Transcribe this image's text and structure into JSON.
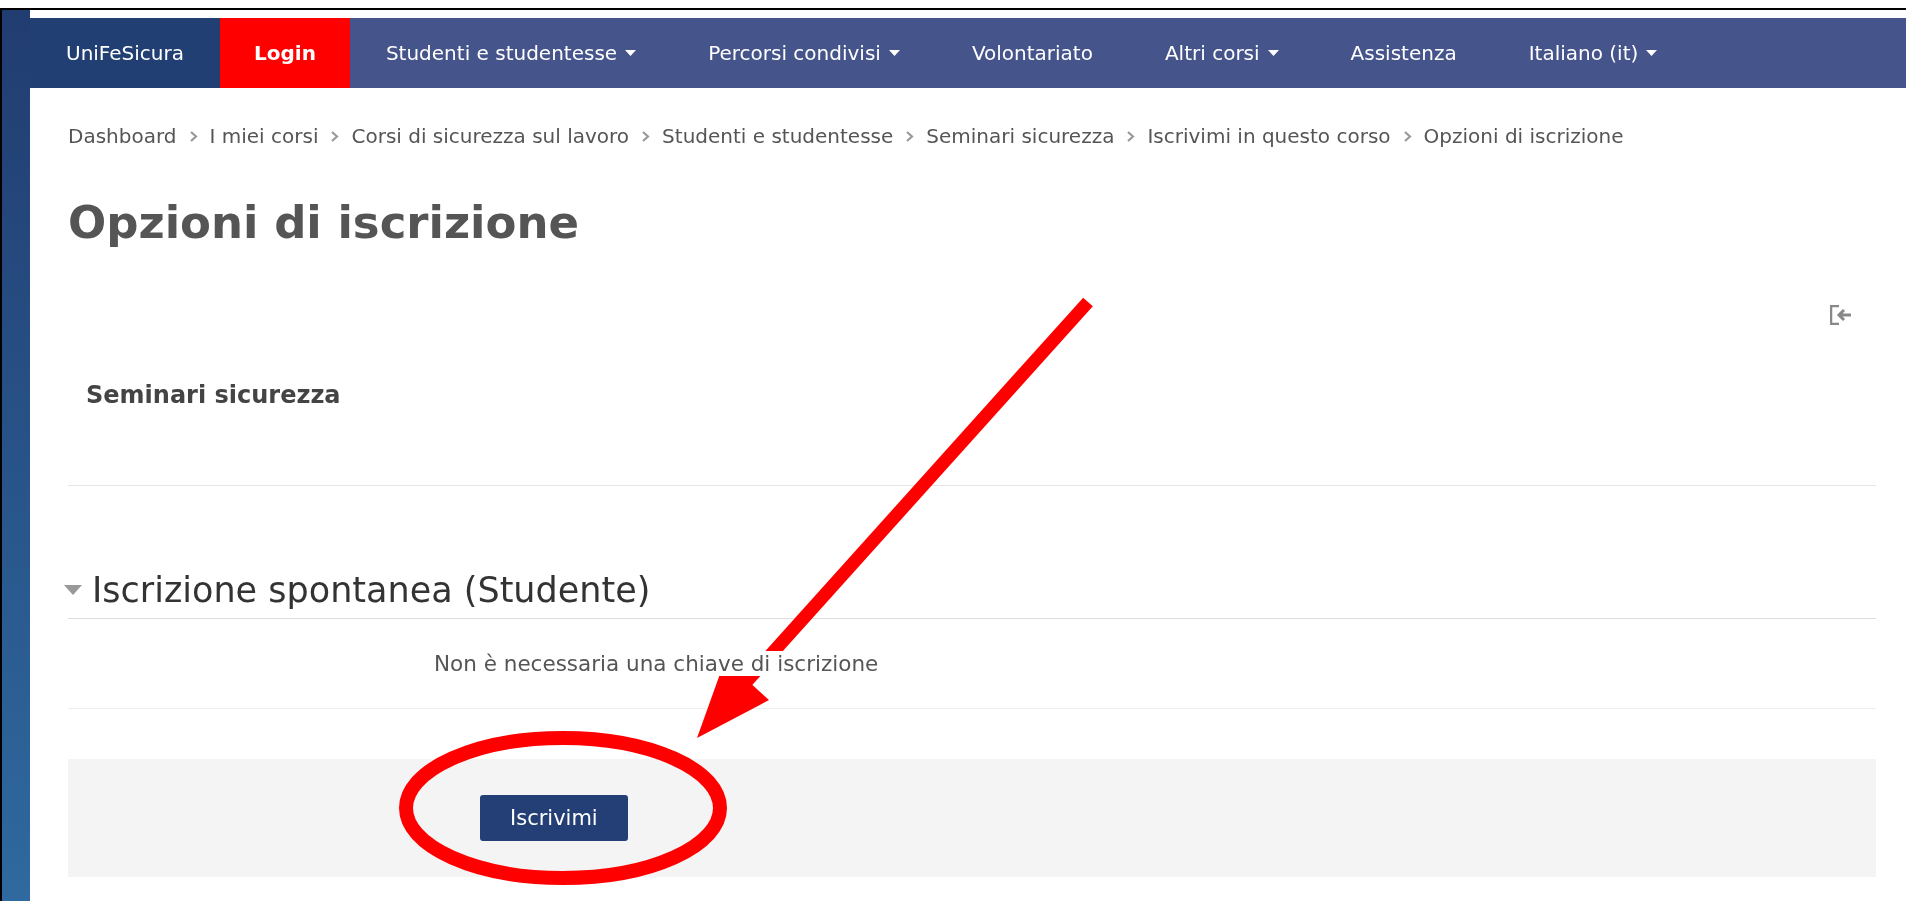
{
  "navbar": {
    "items": [
      {
        "label": "UniFeSicura",
        "kind": "brand",
        "dropdown": false
      },
      {
        "label": "Login",
        "kind": "login",
        "dropdown": false
      },
      {
        "label": "Studenti e studentesse",
        "kind": "link",
        "dropdown": true
      },
      {
        "label": "Percorsi condivisi",
        "kind": "link",
        "dropdown": true
      },
      {
        "label": "Volontariato",
        "kind": "link",
        "dropdown": false
      },
      {
        "label": "Altri corsi",
        "kind": "link",
        "dropdown": true
      },
      {
        "label": "Assistenza",
        "kind": "link",
        "dropdown": false
      },
      {
        "label": "Italiano (it)",
        "kind": "link",
        "dropdown": true
      }
    ]
  },
  "breadcrumb": [
    "Dashboard",
    "I miei corsi",
    "Corsi di sicurezza sul lavoro",
    "Studenti e studentesse",
    "Seminari sicurezza",
    "Iscrivimi in questo corso",
    "Opzioni di iscrizione"
  ],
  "page_title": "Opzioni di iscrizione",
  "course": {
    "name": "Seminari sicurezza"
  },
  "enrolment": {
    "heading": "Iscrizione spontanea (Studente)",
    "expanded": true,
    "note": "Non è necessaria una chiave di iscrizione",
    "button": "Iscrivimi"
  }
}
